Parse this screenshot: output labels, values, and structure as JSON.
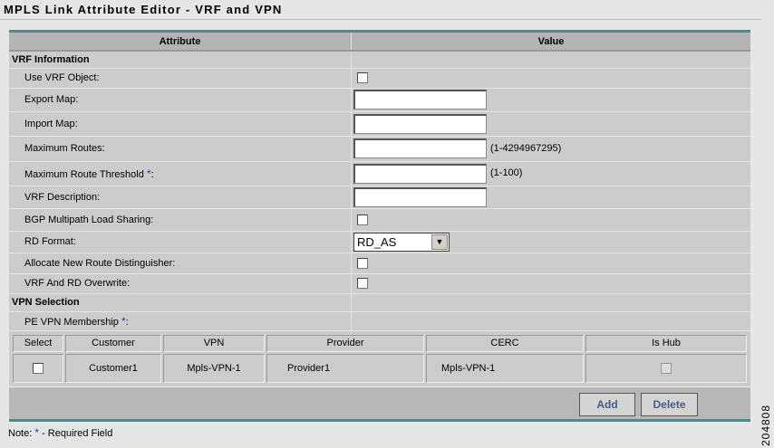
{
  "title": "MPLS Link Attribute Editor - VRF and VPN",
  "columns": {
    "attribute": "Attribute",
    "value": "Value"
  },
  "vrf": {
    "section": "VRF Information",
    "use_vrf": "Use VRF Object:",
    "export_map": "Export Map:",
    "import_map": "Import Map:",
    "max_routes": "Maximum Routes:",
    "max_routes_range": "(1-4294967295)",
    "max_threshold": "Maximum Route Threshold ",
    "max_threshold_range": "(1-100)",
    "description": "VRF Description:",
    "bgp": "BGP Multipath Load Sharing:",
    "rd_format": "RD Format:",
    "rd_format_value": "RD_AS",
    "allocate_rd": "Allocate New Route Distinguisher:",
    "overwrite": "VRF And RD Overwrite:"
  },
  "vpn": {
    "section": "VPN Selection",
    "membership": "PE VPN Membership ",
    "table_headers": [
      "Select",
      "Customer",
      "VPN",
      "Provider",
      "CERC",
      "Is Hub"
    ],
    "rows": [
      {
        "customer": "Customer1",
        "vpn": "Mpls-VPN-1",
        "provider": "Provider1",
        "cerc": "Mpls-VPN-1"
      }
    ]
  },
  "required_mark": "*",
  "colon": ":",
  "buttons": {
    "add": "Add",
    "delete": "Delete"
  },
  "note": {
    "prefix": "Note: ",
    "star": "*",
    "text": " - Required Field"
  },
  "figure_id": "204808"
}
